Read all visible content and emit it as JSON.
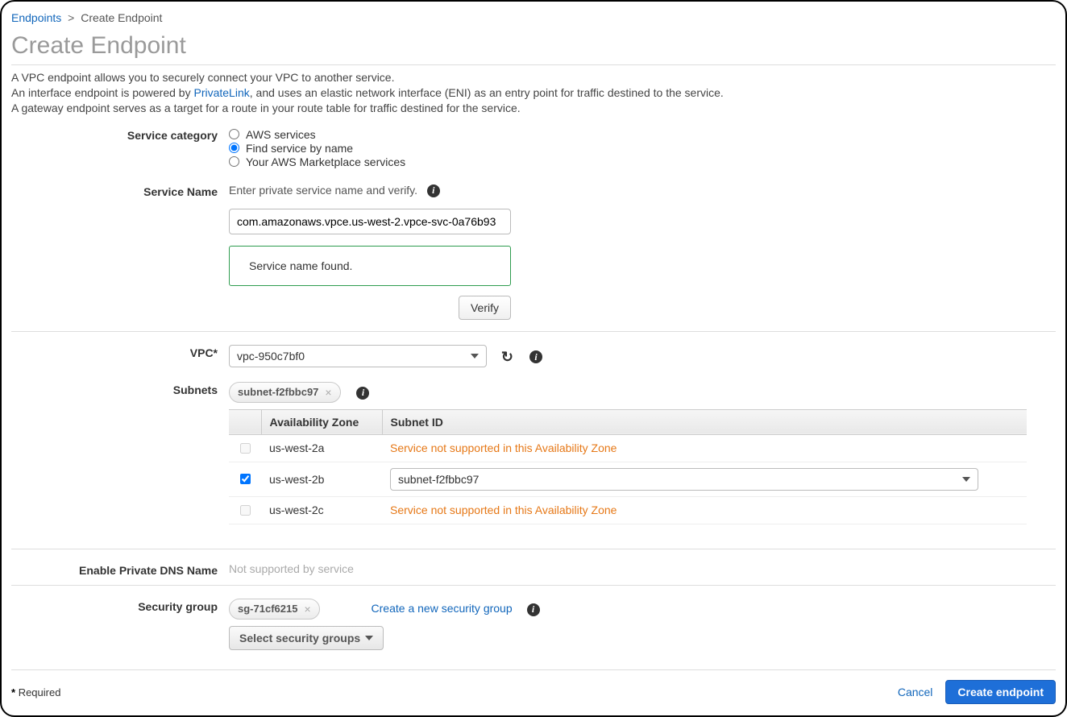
{
  "breadcrumb": {
    "root": "Endpoints",
    "current": "Create Endpoint"
  },
  "page_title": "Create Endpoint",
  "intro": {
    "line1": "A VPC endpoint allows you to securely connect your VPC to another service.",
    "line2a": "An interface endpoint is powered by ",
    "line2_link": "PrivateLink",
    "line2b": ", and uses an elastic network interface (ENI) as an entry point for traffic destined to the service.",
    "line3": "A gateway endpoint serves as a target for a route in your route table for traffic destined for the service."
  },
  "service_category": {
    "label": "Service category",
    "options": {
      "aws": "AWS services",
      "byname": "Find service by name",
      "marketplace": "Your AWS Marketplace services"
    },
    "selected": "byname"
  },
  "service_name": {
    "label": "Service Name",
    "hint": "Enter private service name and verify.",
    "value": "com.amazonaws.vpce.us-west-2.vpce-svc-0a76b93",
    "found_msg": "Service name found.",
    "verify_label": "Verify"
  },
  "vpc": {
    "label": "VPC*",
    "value": "vpc-950c7bf0"
  },
  "subnets": {
    "label": "Subnets",
    "selected_tag": "subnet-f2fbbc97",
    "col_az": "Availability Zone",
    "col_id": "Subnet ID",
    "rows": [
      {
        "checked": false,
        "enabled": false,
        "az": "us-west-2a",
        "msg": "Service not supported in this Availability Zone",
        "subnet": ""
      },
      {
        "checked": true,
        "enabled": true,
        "az": "us-west-2b",
        "msg": "",
        "subnet": "subnet-f2fbbc97"
      },
      {
        "checked": false,
        "enabled": false,
        "az": "us-west-2c",
        "msg": "Service not supported in this Availability Zone",
        "subnet": ""
      }
    ]
  },
  "private_dns": {
    "label": "Enable Private DNS Name",
    "value": "Not supported by service"
  },
  "security_group": {
    "label": "Security group",
    "tag": "sg-71cf6215",
    "create_link": "Create a new security group",
    "select_label": "Select security groups"
  },
  "footer": {
    "required": "Required",
    "cancel": "Cancel",
    "create": "Create endpoint"
  }
}
